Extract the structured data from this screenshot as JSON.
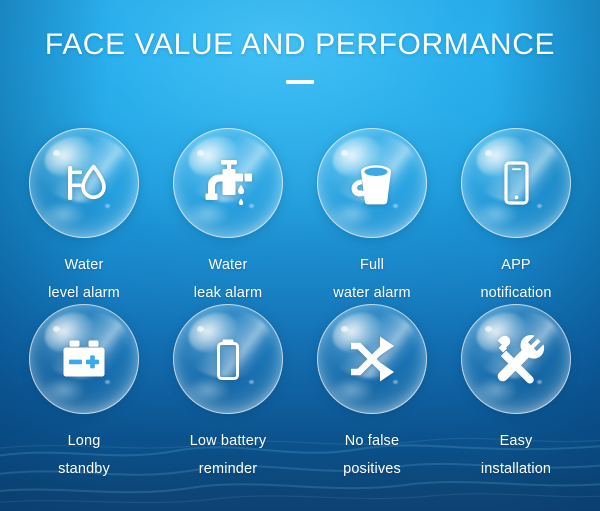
{
  "header": {
    "title": "FACE VALUE AND PERFORMANCE",
    "divider": ""
  },
  "theme": {
    "background_top": "#1ba2e2",
    "background_bottom": "#0d4274",
    "text_color": "#ffffff",
    "icon_color": "#ffffff",
    "bubble_tint": "#bfe9ff"
  },
  "features": [
    {
      "icon": "water-level-gauge-icon",
      "line1": "Water",
      "line2": "level alarm"
    },
    {
      "icon": "faucet-drip-icon",
      "line1": "Water",
      "line2": "leak alarm"
    },
    {
      "icon": "bucket-full-icon",
      "line1": "Full",
      "line2": "water alarm"
    },
    {
      "icon": "smartphone-icon",
      "line1": "APP",
      "line2": "notification"
    },
    {
      "icon": "car-battery-icon",
      "line1": "Long",
      "line2": "standby"
    },
    {
      "icon": "battery-empty-icon",
      "line1": "Low battery",
      "line2": "reminder"
    },
    {
      "icon": "shuffle-arrows-icon",
      "line1": "No false",
      "line2": "positives"
    },
    {
      "icon": "wrench-screwdriver-icon",
      "line1": "Easy",
      "line2": "installation"
    }
  ]
}
